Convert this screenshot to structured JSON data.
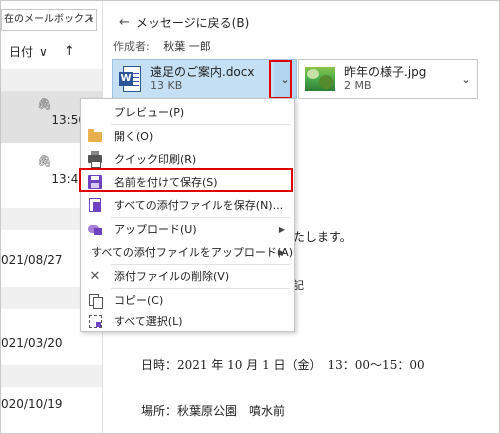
{
  "message_list": {
    "mailbox_label": "在のメールボックス",
    "sort_label": "日付",
    "sort_chevron": "∨",
    "sort_arrow": "↑",
    "times": [
      "13:50",
      "13:47"
    ],
    "dates": [
      "021/08/27",
      "021/03/20",
      "020/10/19"
    ]
  },
  "reading_pane": {
    "back_label": "メッセージに戻る(B)",
    "author_label": "作成者:",
    "author_name": "秋葉 一郎",
    "attachments": [
      {
        "name": "遠足のご案内.docx",
        "size": "13 KB",
        "icon": "word-doc-icon"
      },
      {
        "name": "昨年の様子.jpg",
        "size": "2 MB",
        "icon": "image-thumbnail-icon"
      }
    ],
    "body": {
      "partial_line": "たします。",
      "quote_mark": "記",
      "date_line": "日時：2021 年 10 月 1 日（金）　13：00～15：00",
      "place_line": "場所：秋葉原公園　噴水前"
    }
  },
  "context_menu": {
    "items": [
      {
        "label": "プレビュー(P)",
        "icon": ""
      },
      {
        "label": "開く(O)",
        "icon": "folder-open-icon"
      },
      {
        "label": "クイック印刷(R)",
        "icon": "printer-icon"
      },
      {
        "label": "名前を付けて保存(S)",
        "icon": "save-as-icon"
      },
      {
        "label": "すべての添付ファイルを保存(N)...",
        "icon": "save-all-icon"
      },
      {
        "label": "アップロード(U)",
        "icon": "upload-icon",
        "submenu": "▶"
      },
      {
        "label": "すべての添付ファイルをアップロード(A)",
        "icon": "",
        "submenu": "▶"
      },
      {
        "label": "添付ファイルの削除(V)",
        "icon": "remove-icon"
      },
      {
        "label": "コピー(C)",
        "icon": "copy-icon"
      },
      {
        "label": "すべて選択(L)",
        "icon": "select-all-icon"
      }
    ]
  },
  "colors": {
    "highlight": "#e00000",
    "selected_attachment": "#c5e0f4",
    "accent_purple": "#6f42c1"
  }
}
